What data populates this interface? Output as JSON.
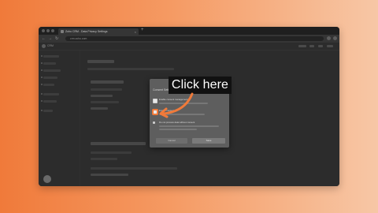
{
  "browser": {
    "tab_title": "Zoho CRM - Data Privacy Settings",
    "tab_close": "×",
    "new_tab": "+",
    "url": "crm.zoho.com",
    "nav": {
      "back": "←",
      "forward": "→",
      "reload": "↻"
    }
  },
  "app": {
    "brand": "CRM"
  },
  "modal": {
    "title": "Consent Settings",
    "options": [
      {
        "label": "Enable consent management",
        "checked": true
      },
      {
        "label": "Enable consent ...",
        "checked": true
      },
      {
        "label": "Do not process data without consent",
        "checked": false
      }
    ],
    "cancel_label": "Cancel",
    "save_label": "Save"
  },
  "annotation": {
    "callout_text": "Click here",
    "accent_color": "#f07a3a"
  }
}
